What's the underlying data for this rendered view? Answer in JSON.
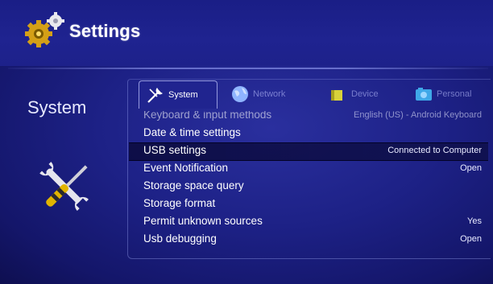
{
  "header": {
    "title": "Settings",
    "icon": "gears-icon"
  },
  "left_panel": {
    "label": "System",
    "icon": "wrench-screwdriver-icon"
  },
  "tabs": [
    {
      "label": "System",
      "icon": "wrench-screwdriver-icon",
      "active": true
    },
    {
      "label": "Network",
      "icon": "globe-icon",
      "active": false
    },
    {
      "label": "Device",
      "icon": "device-icon",
      "active": false
    },
    {
      "label": "Personal",
      "icon": "camera-icon",
      "active": false
    }
  ],
  "settings_list": [
    {
      "label": "Keyboard & input methods",
      "value": "English (US) - Android Keyboard",
      "partially_visible": true
    },
    {
      "label": "Date & time settings",
      "value": ""
    },
    {
      "label": "USB settings",
      "value": "Connected to Computer",
      "selected": true
    },
    {
      "label": "Event Notification",
      "value": "Open"
    },
    {
      "label": "Storage space query",
      "value": ""
    },
    {
      "label": "Storage format",
      "value": ""
    },
    {
      "label": "Permit unknown sources",
      "value": "Yes"
    },
    {
      "label": "Usb debugging",
      "value": "Open"
    }
  ],
  "colors": {
    "background": "#1d2186",
    "selected_row": "#0a0a3c",
    "text": "#ffffff"
  }
}
